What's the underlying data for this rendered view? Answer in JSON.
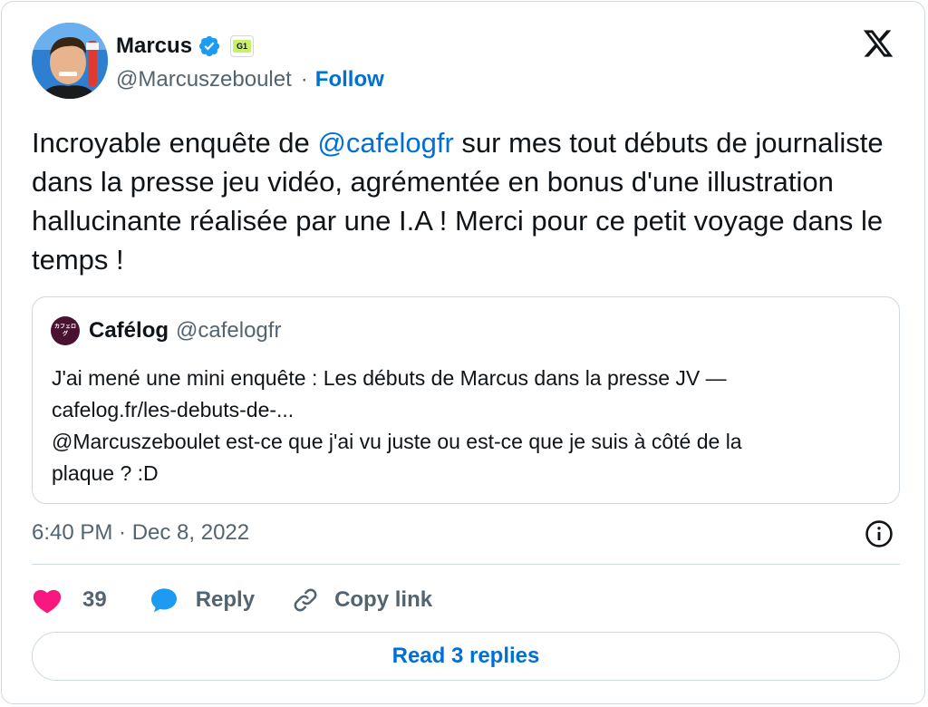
{
  "author": {
    "display_name": "Marcus",
    "handle": "@Marcuszeboulet",
    "follow_label": "Follow",
    "affiliation_badge": "G1"
  },
  "tweet": {
    "text_before": "Incroyable enquête de ",
    "mention": "@cafelogfr",
    "text_after": " sur mes tout débuts de journaliste dans la presse jeu vidéo, agrémentée en bonus d'une illustration hallucinante réalisée par une I.A ! Merci pour ce petit voyage dans le temps !"
  },
  "quote": {
    "name": "Cafélog",
    "handle": "@cafelogfr",
    "avatar_text": "カフェログ",
    "lines": [
      "J'ai mené une mini enquête : Les débuts de Marcus dans la presse JV —",
      "cafelog.fr/les-debuts-de-...",
      "@Marcuszeboulet est-ce que j'ai vu juste ou est-ce que je suis à côté de la",
      "plaque ? :D"
    ]
  },
  "meta": {
    "timestamp": "6:40 PM · Dec 8, 2022"
  },
  "actions": {
    "like_count": "39",
    "reply_label": "Reply",
    "copy_link_label": "Copy link"
  },
  "footer": {
    "read_replies_label": "Read 3 replies"
  },
  "colors": {
    "link": "#006fd6",
    "verified": "#1d9bf0",
    "like": "#f91880",
    "reply": "#1d9bf0",
    "muted_text": "#536471",
    "border": "#cfd9de"
  },
  "icons": [
    "verified-badge-icon",
    "affiliation-badge-icon",
    "x-logo-icon",
    "info-icon",
    "heart-icon",
    "reply-bubble-icon",
    "link-icon"
  ]
}
